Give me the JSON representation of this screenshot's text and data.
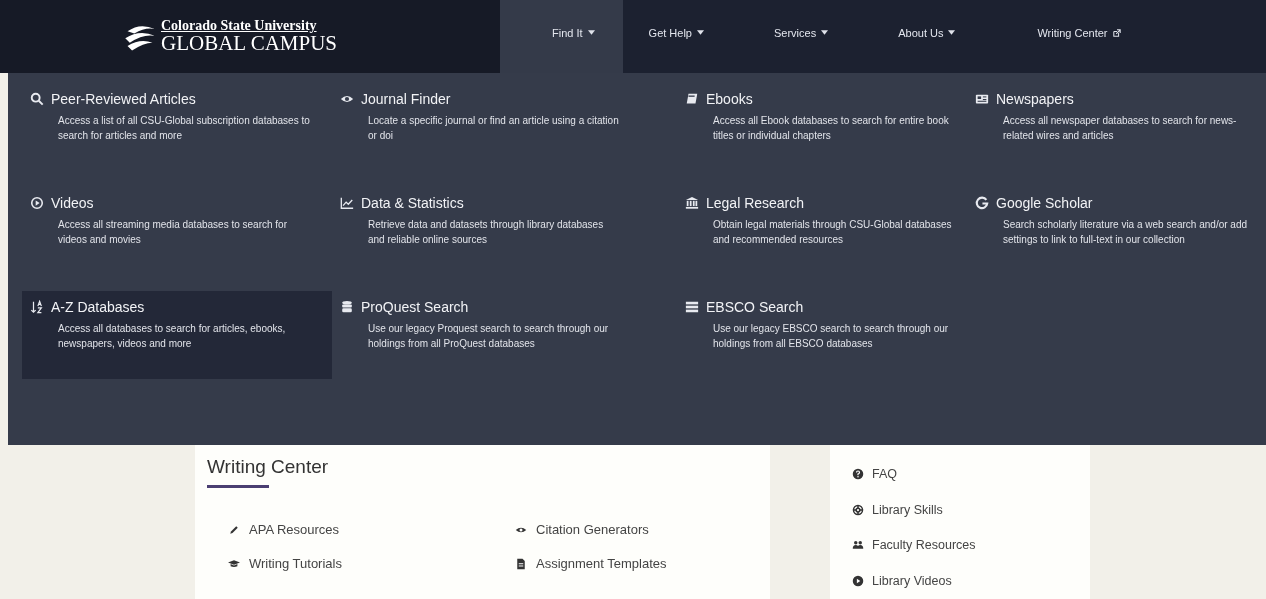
{
  "header": {
    "logo": {
      "line1": "Colorado State University",
      "line2": "GLOBAL CAMPUS"
    },
    "nav": [
      {
        "label": "Find It",
        "kind": "dropdown",
        "selected": true
      },
      {
        "label": "Get Help",
        "kind": "dropdown",
        "selected": false
      },
      {
        "label": "Services",
        "kind": "dropdown",
        "selected": false
      },
      {
        "label": "About Us",
        "kind": "dropdown",
        "selected": false
      },
      {
        "label": "Writing Center",
        "kind": "external",
        "selected": false
      }
    ]
  },
  "menu": [
    {
      "title": "Peer-Reviewed Articles",
      "description": "Access a list of all CSU-Global subscription databases to search for articles and more",
      "selected": false
    },
    {
      "title": "Journal Finder",
      "description": "Locate a specific journal or find an article using a citation or doi",
      "selected": false
    },
    {
      "title": "Ebooks",
      "description": "Access all Ebook databases to search for entire book titles or individual chapters",
      "selected": false
    },
    {
      "title": "Newspapers",
      "description": "Access all newspaper databases to search for news-related wires and articles",
      "selected": false
    },
    {
      "title": "Videos",
      "description": "Access all streaming media databases to search for videos and movies",
      "selected": false
    },
    {
      "title": "Data & Statistics",
      "description": "Retrieve data and datasets through library databases and reliable online sources",
      "selected": false
    },
    {
      "title": "Legal Research",
      "description": "Obtain legal materials through CSU-Global databases and recommended resources",
      "selected": false
    },
    {
      "title": "Google Scholar",
      "description": "Search scholarly literature via a web search and/or add settings to link to full-text in our collection",
      "selected": false
    },
    {
      "title": "A-Z Databases",
      "description": "Access all databases to search for articles, ebooks, newspapers, videos and more",
      "selected": true
    },
    {
      "title": "ProQuest Search",
      "description": "Use our legacy Proquest search to search through our holdings from all ProQuest databases",
      "selected": false
    },
    {
      "title": "EBSCO Search",
      "description": "Use our legacy EBSCO search to search through our holdings from all EBSCO databases",
      "selected": false
    }
  ],
  "writing_center": {
    "title": "Writing Center",
    "links": [
      "APA Resources",
      "Citation Generators",
      "Writing Tutorials",
      "Assignment Templates"
    ]
  },
  "sidebar": {
    "links": [
      "FAQ",
      "Library Skills",
      "Faculty Resources",
      "Library Videos"
    ]
  }
}
